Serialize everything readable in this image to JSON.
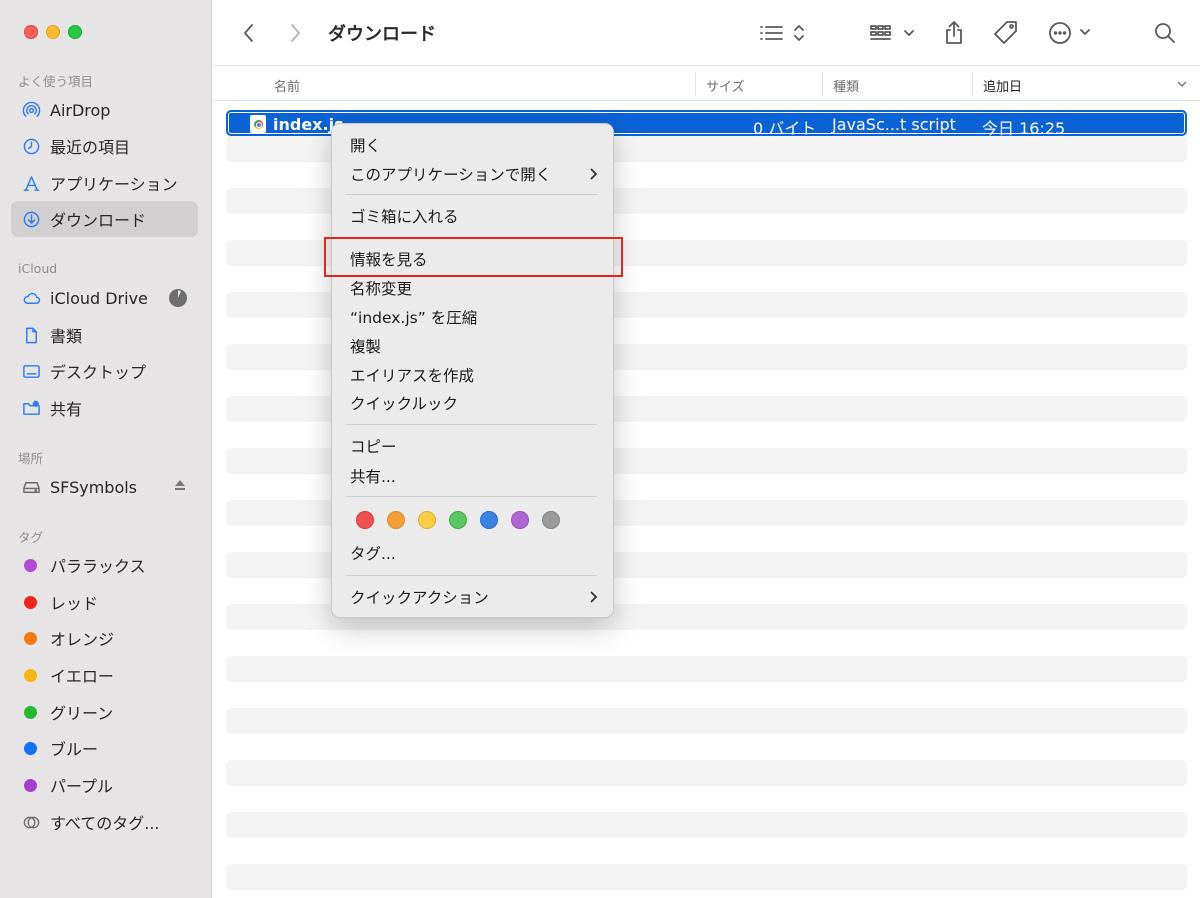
{
  "sidebar": {
    "favorites_label": "よく使う項目",
    "favorites": [
      {
        "label": "AirDrop",
        "icon": "airdrop-icon"
      },
      {
        "label": "最近の項目",
        "icon": "clock-icon"
      },
      {
        "label": "アプリケーション",
        "icon": "applications-icon"
      },
      {
        "label": "ダウンロード",
        "icon": "download-icon"
      }
    ],
    "icloud_label": "iCloud",
    "icloud": [
      {
        "label": "iCloud Drive",
        "icon": "cloud-icon"
      },
      {
        "label": "書類",
        "icon": "document-icon"
      },
      {
        "label": "デスクトップ",
        "icon": "desktop-icon"
      },
      {
        "label": "共有",
        "icon": "shared-folder-icon"
      }
    ],
    "locations_label": "場所",
    "locations": [
      {
        "label": "SFSymbols",
        "icon": "drive-icon"
      }
    ],
    "tags_label": "タグ",
    "tags": [
      {
        "label": "パララックス",
        "color": "#b04cd8"
      },
      {
        "label": "レッド",
        "color": "#f2231b"
      },
      {
        "label": "オレンジ",
        "color": "#f5790f"
      },
      {
        "label": "イエロー",
        "color": "#f6b515"
      },
      {
        "label": "グリーン",
        "color": "#28b82f"
      },
      {
        "label": "ブルー",
        "color": "#1470f5"
      },
      {
        "label": "パープル",
        "color": "#a53fd0"
      },
      {
        "label": "すべてのタグ..."
      }
    ]
  },
  "toolbar": {
    "title": "ダウンロード",
    "icons": [
      "back-icon",
      "forward-icon",
      "list-view-icon",
      "group-icon",
      "share-icon",
      "tag-icon",
      "more-icon",
      "search-icon"
    ]
  },
  "columns": {
    "name": "名前",
    "size": "サイズ",
    "kind": "種類",
    "date_added": "追加日"
  },
  "files": [
    {
      "name": "index.js",
      "size": "0 バイト",
      "kind": "JavaSc...t script",
      "date_added": "今日 16:25",
      "selected": true
    }
  ],
  "context_menu": {
    "open": "開く",
    "open_with": "このアプリケーションで開く",
    "move_to_trash": "ゴミ箱に入れる",
    "get_info": "情報を見る",
    "rename": "名称変更",
    "compress": "“index.js” を圧縮",
    "duplicate": "複製",
    "make_alias": "エイリアスを作成",
    "quick_look": "クイックルック",
    "copy": "コピー",
    "share": "共有...",
    "tag_colors": [
      "#f05150",
      "#f4a03a",
      "#f7ce45",
      "#5ac561",
      "#3b82e6",
      "#b066d6",
      "#9a9a9a"
    ],
    "tags": "タグ...",
    "quick_actions": "クイックアクション"
  },
  "colors": {
    "selection": "#0a63d6",
    "annotation": "#e5261f"
  }
}
